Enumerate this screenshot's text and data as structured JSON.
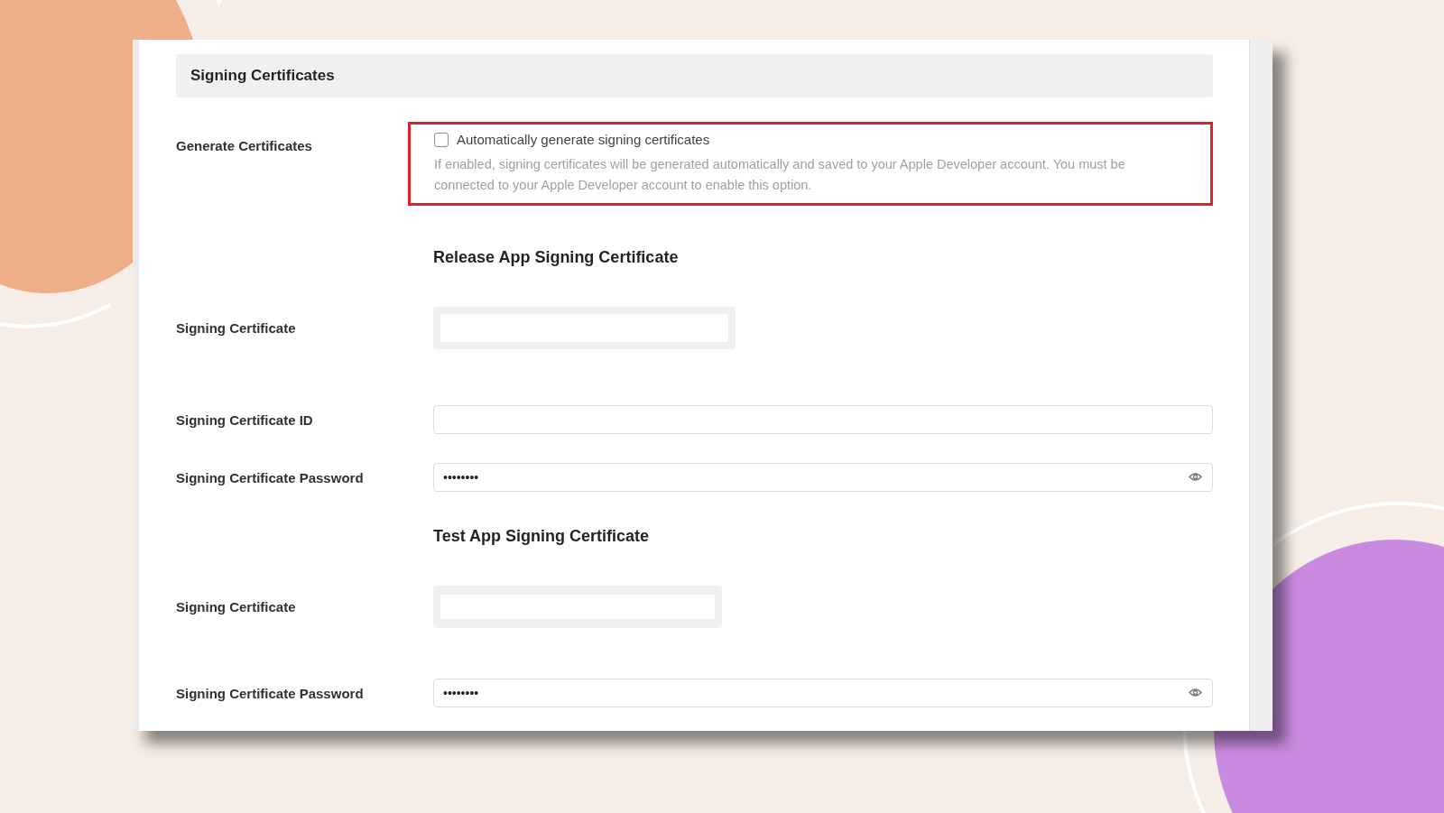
{
  "section": {
    "title": "Signing Certificates"
  },
  "generate": {
    "label": "Generate Certificates",
    "highlighted": true,
    "checkbox": {
      "label": "Automatically generate signing certificates",
      "checked": false
    },
    "description": "If enabled, signing certificates will be generated automatically and saved to your Apple Developer account. You must be connected to your Apple Developer account to enable this option."
  },
  "rows": [
    {
      "kind": "heading",
      "text": "Release App Signing Certificate"
    },
    {
      "kind": "file",
      "label": "Signing Certificate"
    },
    {
      "kind": "text",
      "label": "Signing Certificate ID"
    },
    {
      "kind": "password",
      "label": "Signing Certificate Password",
      "value": "••••••••"
    },
    {
      "kind": "heading",
      "text": "Test App Signing Certificate"
    },
    {
      "kind": "file",
      "label": "Signing Certificate"
    },
    {
      "kind": "password",
      "label": "Signing Certificate Password",
      "value": "••••••••"
    }
  ]
}
